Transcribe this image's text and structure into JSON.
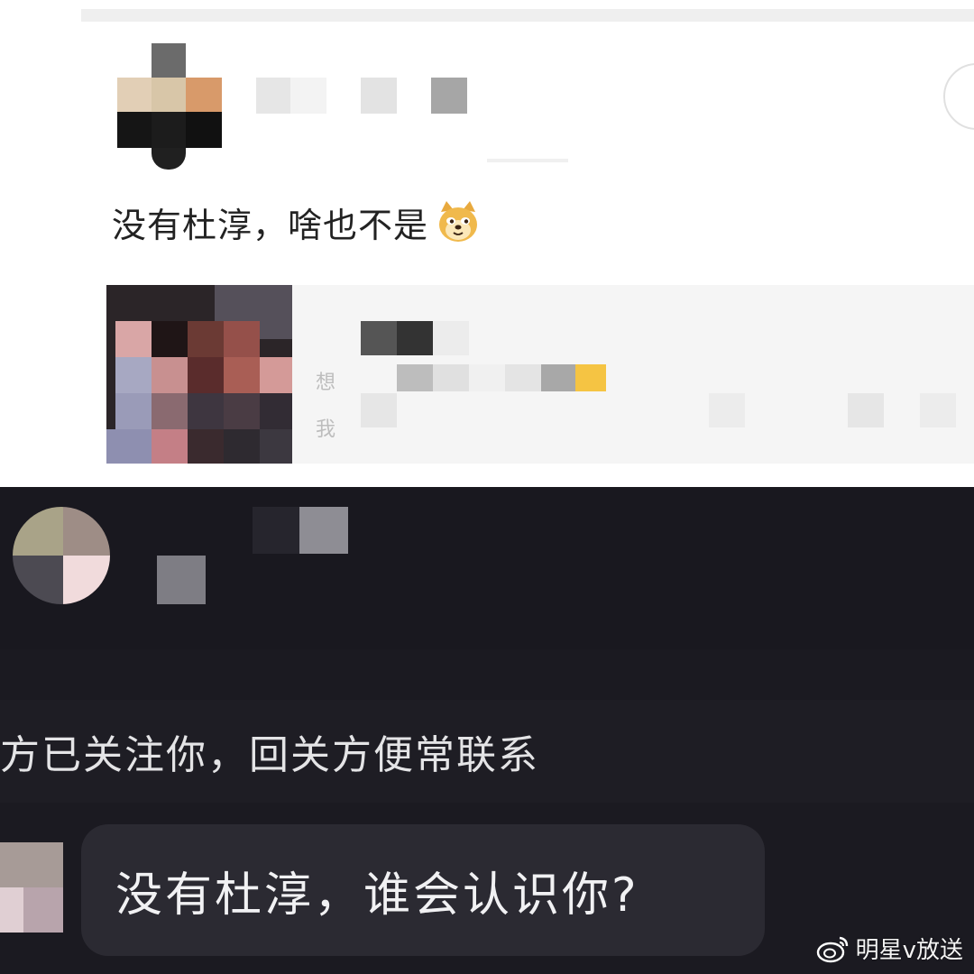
{
  "top_post": {
    "comment_text": "没有杜淳，啥也不是",
    "emoji": "doge-emoji",
    "quote_snippet": {
      "line1_start": "想",
      "line2_start": "我"
    }
  },
  "dark_chat": {
    "system_line": "方已关注你，回关方便常联系",
    "reply_bubble": "没有杜淳，谁会认识你?"
  },
  "watermark": {
    "text": "明星v放送",
    "icon": "weibo-icon"
  },
  "colors": {
    "dark_bg": "#1b1a21",
    "bubble_bg": "#2b2a32",
    "light_bg": "#ffffff"
  }
}
